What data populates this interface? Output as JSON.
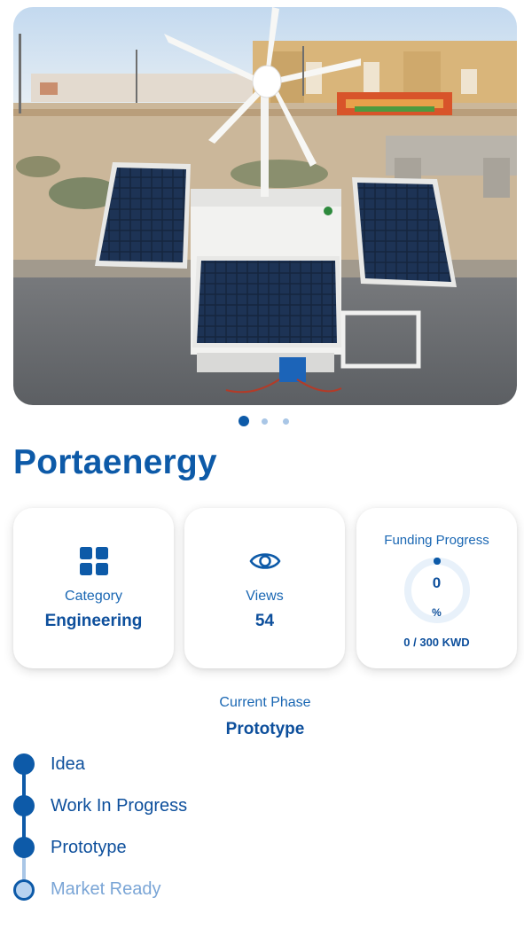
{
  "project": {
    "title": "Portaenergy",
    "image_description_icon": "solar-wind-generator-photo"
  },
  "carousel": {
    "total": 3,
    "active": 1
  },
  "stats": {
    "category": {
      "label": "Category",
      "value": "Engineering",
      "icon": "grid-icon"
    },
    "views": {
      "label": "Views",
      "value": "54",
      "icon": "eye-icon"
    },
    "funding": {
      "label": "Funding Progress",
      "percent": "0",
      "percent_sign": "%",
      "amount": "0 / 300 KWD",
      "progress_fraction": 0
    }
  },
  "phase": {
    "label": "Current Phase",
    "value": "Prototype"
  },
  "timeline": [
    {
      "label": "Idea",
      "state": "done"
    },
    {
      "label": "Work In Progress",
      "state": "done"
    },
    {
      "label": "Prototype",
      "state": "done"
    },
    {
      "label": "Market Ready",
      "state": "todo"
    }
  ],
  "colors": {
    "primary": "#0d5aa8",
    "light": "#a9c6e6"
  }
}
